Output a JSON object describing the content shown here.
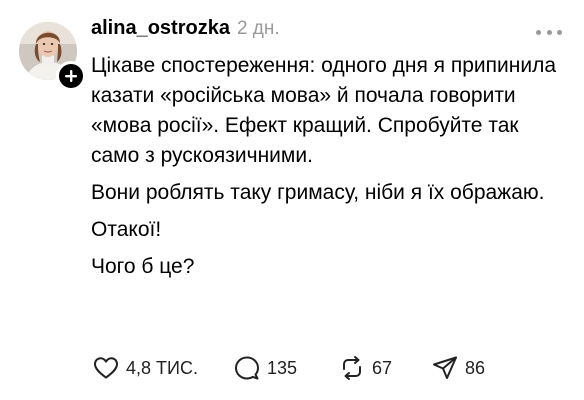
{
  "post": {
    "username": "alina_ostrozka",
    "timestamp": "2 дн.",
    "paragraphs": [
      "Цікаве спостереження: одного дня я припинила казати «російська мова» й почала говорити «мова росії». Ефект кращий. Спробуйте так само з рускоязичними.",
      "Вони роблять таку гримасу, ніби я їх ображаю.",
      "Отакої!",
      "Чого б це?"
    ]
  },
  "actions": {
    "likes": "4,8 ТИС.",
    "replies": "135",
    "reposts": "67",
    "shares": "86"
  },
  "icons": {
    "like": "heart-icon",
    "reply": "speech-bubble-icon",
    "repost": "repost-icon",
    "share": "paper-plane-icon",
    "follow": "plus-icon",
    "more": "more-dots-icon"
  },
  "colors": {
    "text": "#000000",
    "muted": "#9a9a9a",
    "background": "#ffffff"
  }
}
